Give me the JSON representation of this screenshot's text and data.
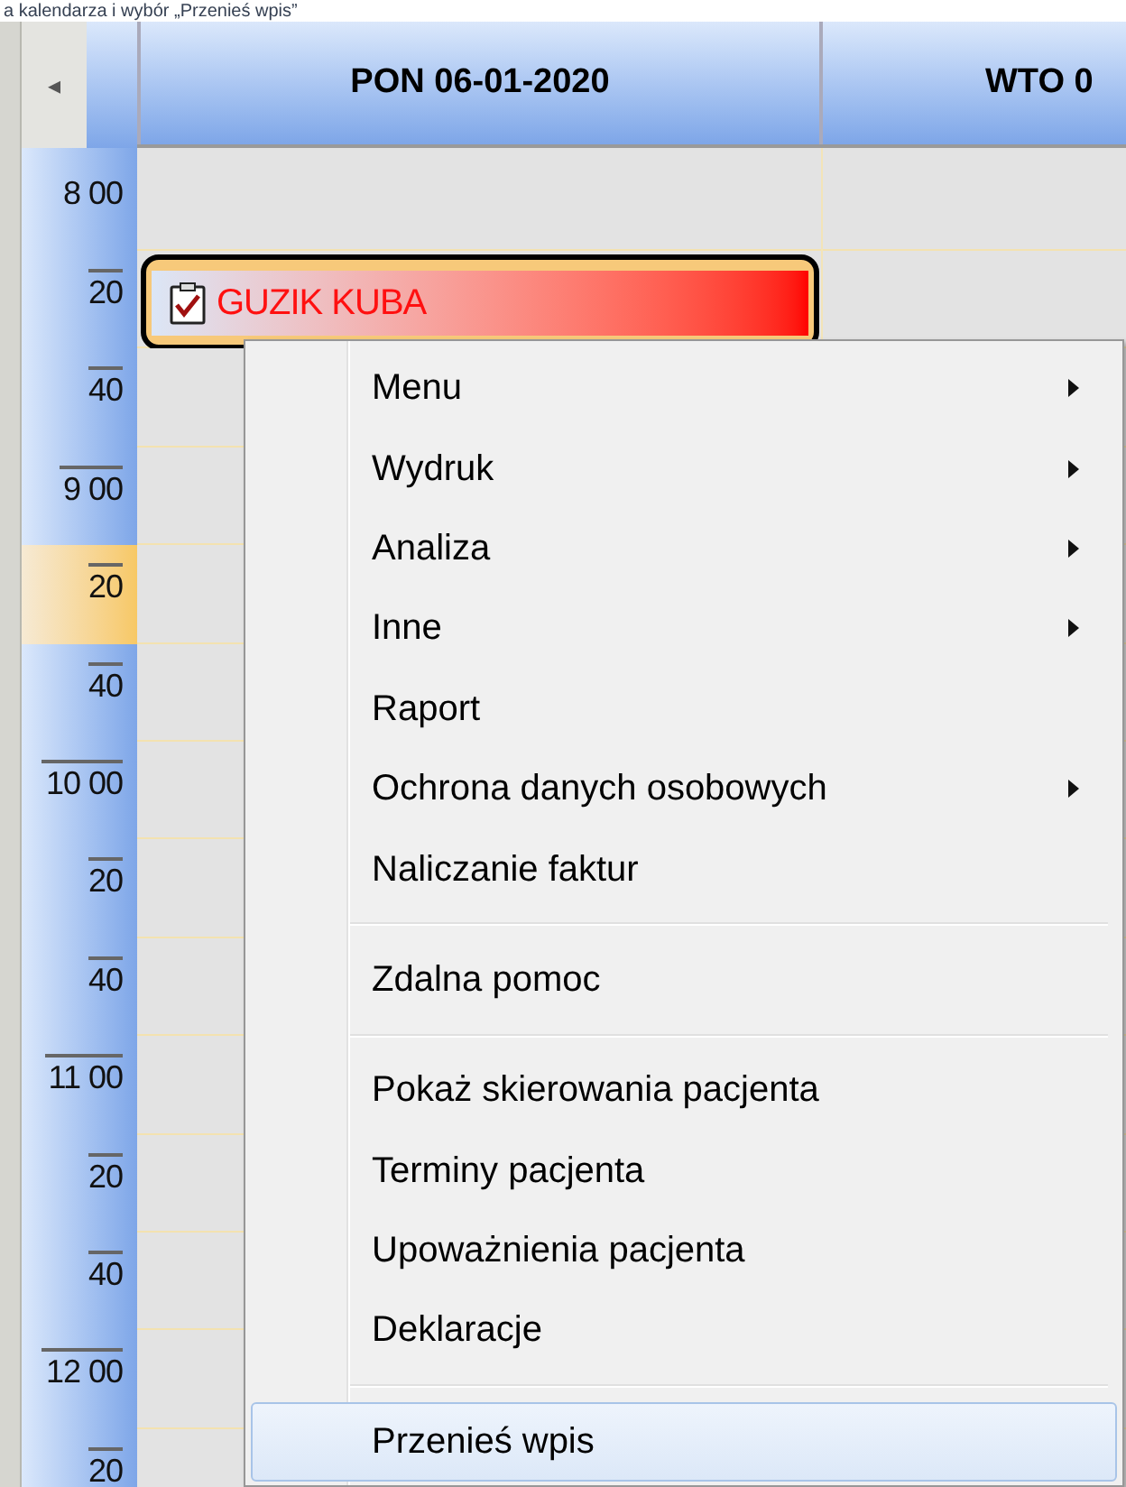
{
  "caption": "a kalendarza i wybór „Przenieś wpis”",
  "header": {
    "scroll_left": "◂",
    "days": [
      {
        "label": "PON 06-01-2020"
      },
      {
        "label": "WTO 0"
      }
    ]
  },
  "time_slots": [
    {
      "label": "8 00",
      "kind": "hour",
      "highlighted": false
    },
    {
      "label": "20",
      "kind": "minute",
      "highlighted": false
    },
    {
      "label": "40",
      "kind": "minute",
      "highlighted": false
    },
    {
      "label": "9 00",
      "kind": "hour",
      "highlighted": false
    },
    {
      "label": "20",
      "kind": "minute",
      "highlighted": true
    },
    {
      "label": "40",
      "kind": "minute",
      "highlighted": false
    },
    {
      "label": "10 00",
      "kind": "hour",
      "highlighted": false
    },
    {
      "label": "20",
      "kind": "minute",
      "highlighted": false
    },
    {
      "label": "40",
      "kind": "minute",
      "highlighted": false
    },
    {
      "label": "11 00",
      "kind": "hour",
      "highlighted": false
    },
    {
      "label": "20",
      "kind": "minute",
      "highlighted": false
    },
    {
      "label": "40",
      "kind": "minute",
      "highlighted": false
    },
    {
      "label": "12 00",
      "kind": "hour",
      "highlighted": false
    },
    {
      "label": "20",
      "kind": "minute",
      "highlighted": false
    }
  ],
  "appointment": {
    "name": "GUZIK KUBA",
    "checked": true,
    "selected": true
  },
  "context_menu": [
    {
      "kind": "item",
      "label": "Menu",
      "submenu": true,
      "selected": false
    },
    {
      "kind": "item",
      "label": "Wydruk",
      "submenu": true,
      "selected": false
    },
    {
      "kind": "item",
      "label": "Analiza",
      "submenu": true,
      "selected": false
    },
    {
      "kind": "item",
      "label": "Inne",
      "submenu": true,
      "selected": false
    },
    {
      "kind": "item",
      "label": "Raport",
      "submenu": false,
      "selected": false
    },
    {
      "kind": "item",
      "label": "Ochrona danych osobowych",
      "submenu": true,
      "selected": false
    },
    {
      "kind": "item",
      "label": "Naliczanie faktur",
      "submenu": false,
      "selected": false
    },
    {
      "kind": "separator"
    },
    {
      "kind": "item",
      "label": "Zdalna pomoc",
      "submenu": false,
      "selected": false
    },
    {
      "kind": "separator"
    },
    {
      "kind": "item",
      "label": "Pokaż skierowania pacjenta",
      "submenu": false,
      "selected": false
    },
    {
      "kind": "item",
      "label": "Terminy pacjenta",
      "submenu": false,
      "selected": false
    },
    {
      "kind": "item",
      "label": "Upoważnienia pacjenta",
      "submenu": false,
      "selected": false
    },
    {
      "kind": "item",
      "label": "Deklaracje",
      "submenu": false,
      "selected": false
    },
    {
      "kind": "separator"
    },
    {
      "kind": "item",
      "label": "Przenieś wpis",
      "submenu": false,
      "selected": true
    }
  ]
}
